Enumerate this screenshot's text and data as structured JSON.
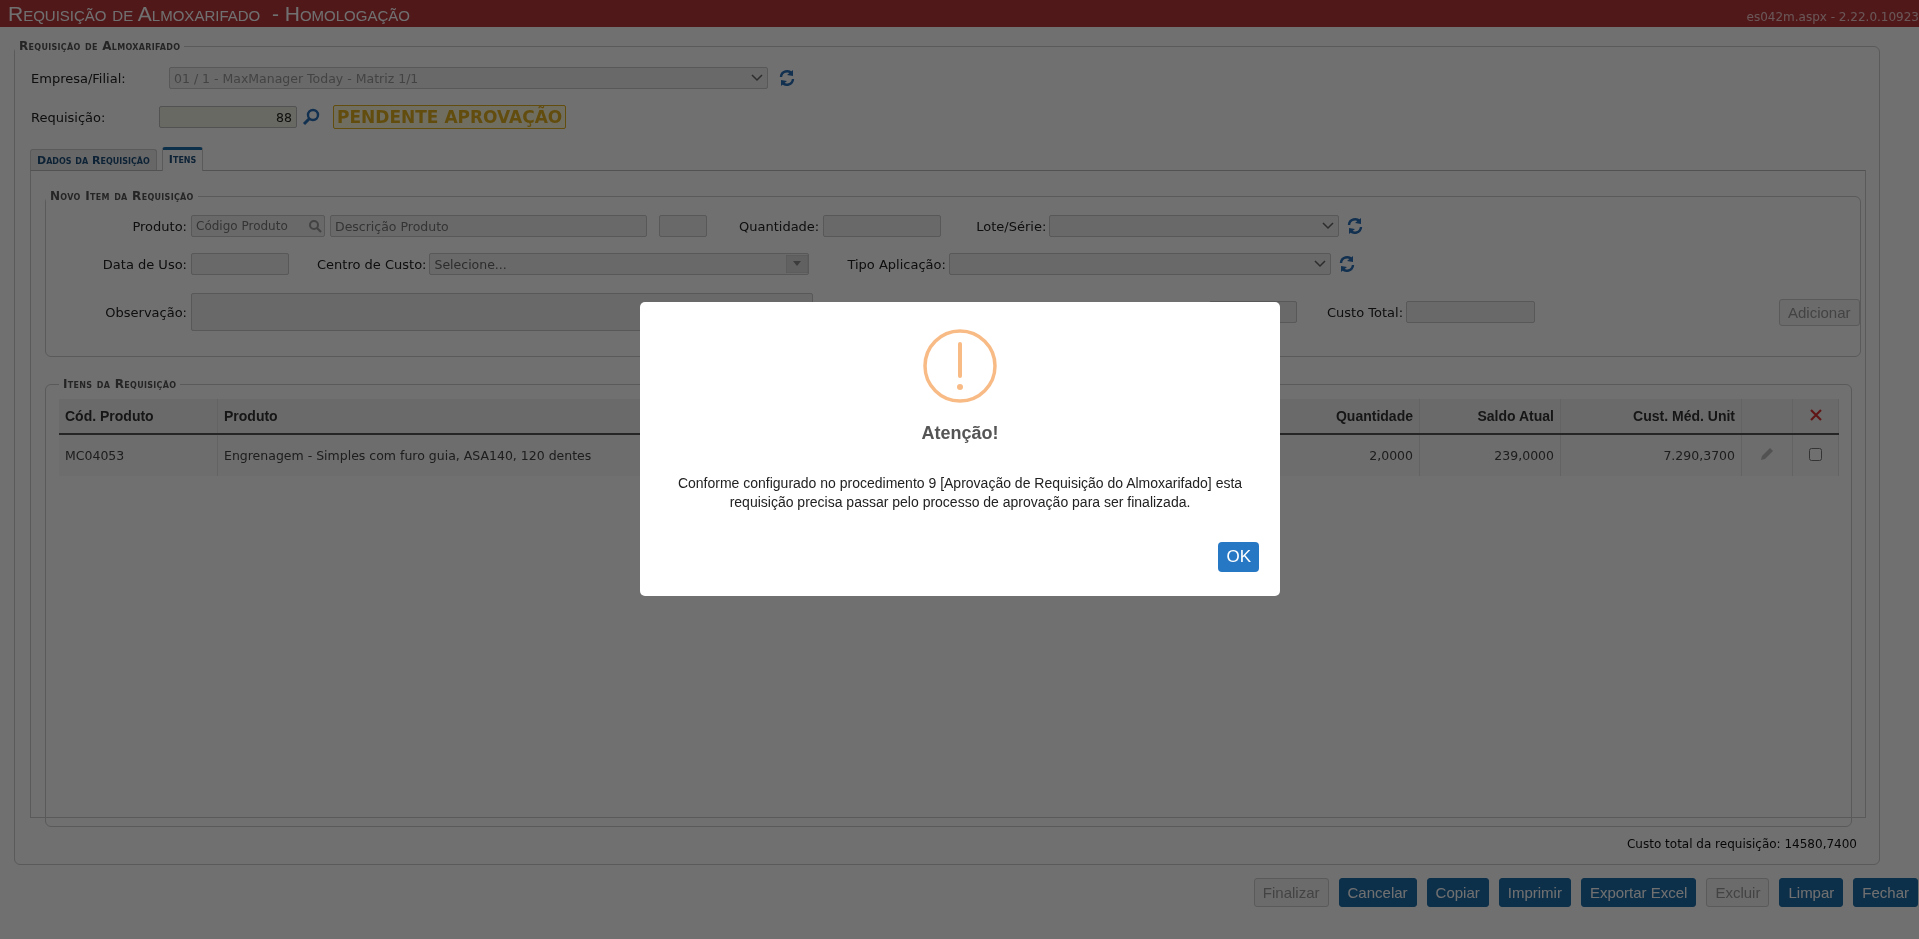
{
  "header": {
    "title": "Requisição de Almoxarifado  - Homologação",
    "version": "es042m.aspx - 2.22.0.10923"
  },
  "form": {
    "legend": "Requisição de Almoxarifado",
    "company_label": "Empresa/Filial:",
    "company_value": "01 / 1 - MaxManager Today - Matriz 1/1",
    "request_label": "Requisição:",
    "request_value": "88",
    "status": "PENDENTE APROVAÇÃO"
  },
  "tabs": [
    {
      "label": "Dados da Requisição",
      "selected": false
    },
    {
      "label": "Itens",
      "selected": true
    }
  ],
  "new_item": {
    "legend": "Novo Item da Requisição",
    "product_label": "Produto:",
    "code_placeholder": "Código Produto",
    "description_placeholder": "Descrição Produto",
    "quantity_label": "Quantidade:",
    "lot_label": "Lote/Série:",
    "use_date_label": "Data de Uso:",
    "cost_center_label": "Centro de Custo:",
    "cost_center_value": "Selecione...",
    "application_label": "Tipo Aplicação:",
    "note_label": "Observação:",
    "total_cost_label": "Custo Total:",
    "add_button": {
      "label": "Adicionar",
      "disabled": true
    }
  },
  "items": {
    "legend": "Itens da Requisição",
    "columns": [
      "Cód. Produto",
      "Produto",
      "Quantidade",
      "Saldo Atual",
      "Cust. Méd. Unit"
    ],
    "rows": [
      {
        "cells": [
          "MC04053",
          "Engrenagem - Simples com furo guia, ASA140, 120 dentes",
          "2,0000",
          "239,0000",
          "7.290,3700"
        ],
        "checked": false
      }
    ],
    "total": "Custo total da requisição: 14580,7400"
  },
  "buttons": [
    {
      "label": "Finalizar",
      "disabled": true
    },
    {
      "label": "Cancelar",
      "disabled": false
    },
    {
      "label": "Copiar",
      "disabled": false
    },
    {
      "label": "Imprimir",
      "disabled": false
    },
    {
      "label": "Exportar Excel",
      "disabled": false
    },
    {
      "label": "Excluir",
      "disabled": true
    },
    {
      "label": "Limpar",
      "disabled": false
    },
    {
      "label": "Fechar",
      "disabled": false
    }
  ],
  "dialog": {
    "title": "Atenção!",
    "message": "Conforme configurado no procedimento 9 [Aprovação de Requisição do Almoxarifado] esta requisição precisa passar pelo processo de aprovação para ser finalizada.",
    "ok": "OK"
  }
}
